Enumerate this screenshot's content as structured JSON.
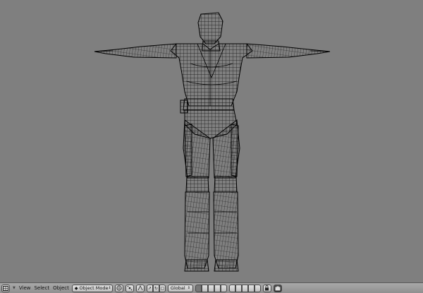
{
  "header": {
    "menus": [
      "View",
      "Select",
      "Object"
    ],
    "mode": "Object Mode",
    "orientation": "Global",
    "icons": {
      "editor_type": "3d-view-icon",
      "mode": "object-mode-icon",
      "viewport_shading": "wireframe-shading-icon",
      "pivot": "pivot-point-icon",
      "manipulator": "manipulator-icon",
      "snap": "magnet-icon",
      "render": "render-icon",
      "layers": "layers-icon",
      "lock": "lock-icon",
      "camera": "camera-icon"
    }
  },
  "viewport": {
    "shading": "wireframe",
    "background": "#7f7f7f",
    "wire_color": "#000000"
  }
}
